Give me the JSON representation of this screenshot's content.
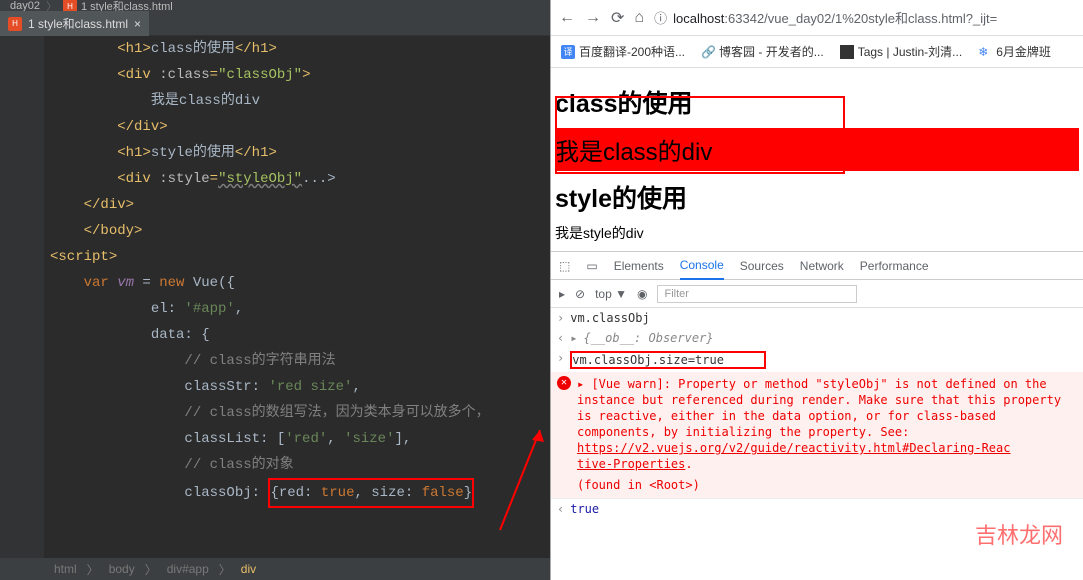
{
  "ide": {
    "top_breadcrumb": "day02",
    "top_file": "1 style和class.html",
    "tab": "1 style和class.html",
    "tab_close": "×",
    "breadcrumbs": [
      "html",
      "body",
      "div#app",
      "div"
    ]
  },
  "code": {
    "l1": "<h1>class的使用</h1>",
    "l2_open": "<div ",
    "l2_attr": ":class=",
    "l2_val": "\"classObj\"",
    "l2_close": ">",
    "l3": "我是class的div",
    "l4": "</div>",
    "l5": "<h1>style的使用</h1>",
    "l6_open": "<div ",
    "l6_attr": ":style=",
    "l6_val": "\"styleObj\"",
    "l6_dots": "...>",
    "l7": "</div>",
    "l8": "</body>",
    "l9": "<script>",
    "l10_var": "var ",
    "l10_vm": "vm",
    "l10_eq": " = ",
    "l10_new": "new ",
    "l10_vue": "Vue({",
    "l11_el": "el: ",
    "l11_val": "'#app'",
    "l11_comma": ",",
    "l12_data": "data: {",
    "l13": "// class的字符串用法",
    "l14_key": "classStr: ",
    "l14_val": "'red size'",
    "l14_comma": ",",
    "l15": "// class的数组写法，因为类本身可以放多个，",
    "l16_key": "classList: [",
    "l16_v1": "'red'",
    "l16_c": ", ",
    "l16_v2": "'size'",
    "l16_close": "],",
    "l17": "// class的对象",
    "l18_key": "classObj: ",
    "l18_obj": "{red: ",
    "l18_t": "true",
    "l18_c": ", size: ",
    "l18_f": "false",
    "l18_close": "}"
  },
  "browser": {
    "url_host": "localhost",
    "url_path": ":63342/vue_day02/1%20style和class.html?_ijt=",
    "bookmarks": {
      "b1": "百度翻译-200种语...",
      "b2": "博客园 - 开发者的...",
      "b3": "Tags | Justin-刘清...",
      "b4": "6月金牌班"
    }
  },
  "page": {
    "h1": "class的使用",
    "div_text": "我是class的div",
    "h2": "style的使用",
    "style_div": "我是style的div"
  },
  "devtools": {
    "tabs": {
      "elements": "Elements",
      "console": "Console",
      "sources": "Sources",
      "network": "Network",
      "performance": "Performance"
    },
    "top": "top ▼",
    "filter": "Filter",
    "console": {
      "l1": "vm.classObj",
      "l2": "{__ob__: Observer}",
      "l3": "vm.classObj.size=true",
      "warn": "[Vue warn]: Property or method \"styleObj\" is not defined on the instance but referenced during render. Make sure that this property is reactive, either in the data option, or for class-based components, by initializing the property. See: ",
      "warn_link": "https://v2.vuejs.org/v2/guide/reactivity.html#Declaring-Reactive-Properties",
      "warn_link_short": "tive-Properties",
      "found": "(found in <Root>)",
      "result": "true"
    }
  },
  "watermark": "吉林龙网"
}
